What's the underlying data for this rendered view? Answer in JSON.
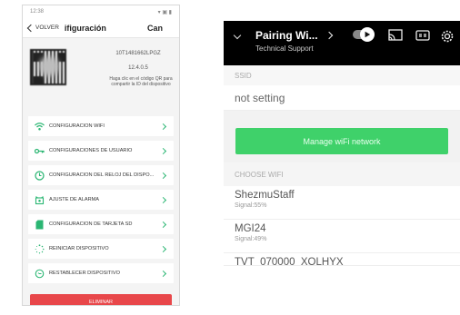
{
  "left": {
    "status_time": "12:38",
    "status_icons": "▾ ▣ ▮",
    "back_label": "VOLVER",
    "nav_title": "ifiguración",
    "nav_right": "Can",
    "device_id": "10T1481662LPGZ",
    "version": "12.4.0.5",
    "qr_hint": "Haga clic en el código QR para compartir la ID del dispositivo",
    "menu": [
      {
        "label": "CONFIGURACIÓN WIFI",
        "icon": "wifi-icon"
      },
      {
        "label": "CONFIGURACIONES DE USUARIO",
        "icon": "key-icon"
      },
      {
        "label": "CONFIGURACIÓN DEL RELOJ DEL DISPO...",
        "icon": "clock-icon"
      },
      {
        "label": "AJUSTE DE ALARMA",
        "icon": "alarm-icon"
      },
      {
        "label": "CONFIGURACIÓN DE TARJETA SD",
        "icon": "sd-card-icon"
      },
      {
        "label": "REINICIAR DISPOSITIVO",
        "icon": "restart-icon"
      },
      {
        "label": "RESTABLECER DISPOSITIVO",
        "icon": "reset-icon"
      }
    ],
    "delete_label": "ELIMINAR"
  },
  "right": {
    "title": "Pairing Wi...",
    "subtitle": "Technical Support",
    "ssid_section": "SSID",
    "ssid_value": "not setting",
    "manage_button": "Manage wiFi network",
    "choose_section": "CHOOSE WIFI",
    "networks": [
      {
        "name": "ShezmuStaff",
        "signal": "Signal:55%"
      },
      {
        "name": "MGI24",
        "signal": "Signal:49%"
      },
      {
        "name": "TVT_070000_XOLHYX",
        "signal": ""
      }
    ]
  },
  "colors": {
    "accent_green": "#2bb673",
    "button_green": "#3fd16a",
    "delete_red": "#e8474a",
    "topbar_black": "#000000"
  }
}
